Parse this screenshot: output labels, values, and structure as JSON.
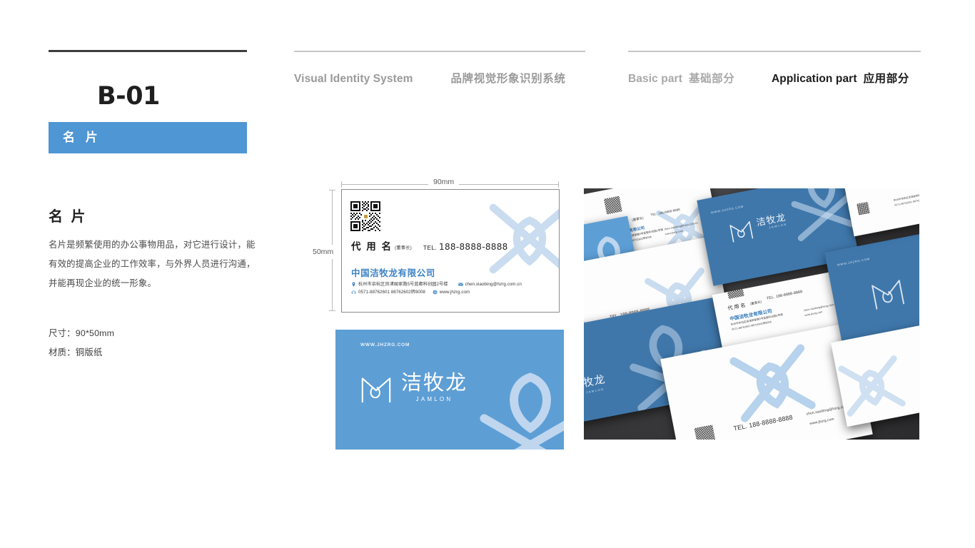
{
  "header": {
    "nav": [
      {
        "en": "Visual Identity System",
        "cn": "品牌视觉形象识别系统",
        "active": false
      },
      {
        "en": "Basic part",
        "cn": "基础部分",
        "active": false
      },
      {
        "en": "Application part",
        "cn": "应用部分",
        "active": true
      }
    ]
  },
  "left": {
    "code": "B-01",
    "band_label": "名 片",
    "section_title": "名 片",
    "body": "名片是频繁使用的办公事物用品，对它进行设计，能有效的提高企业的工作效率，与外界人员进行沟通，并能再现企业的统一形象。",
    "spec_size": "尺寸：90*50mm",
    "spec_material": "材质：铜版纸"
  },
  "dimensions": {
    "width_label": "90mm",
    "height_label": "50mm"
  },
  "card_front": {
    "person_name": "代 用 名",
    "person_title": "(董事长)",
    "tel_label": "TEL.",
    "tel_number": "188-8888-8888",
    "company": "中国洁牧龙有限公司",
    "address": "杭州市余杭区良渚娱家路5号蓝都科创园2号楼",
    "email": "chen.xiaobing@hzrg.com.cn",
    "phone": "0571-88762601 88762602转8008",
    "website": "www.jhzrg.com",
    "icons": {
      "address": "location-pin-icon",
      "email": "envelope-icon",
      "phone": "telephone-icon",
      "website": "globe-icon",
      "qr": "qr-code-icon"
    }
  },
  "card_back": {
    "url": "WWW.JHZRG.COM",
    "logo_cn": "洁牧龙",
    "logo_en": "JAMLON",
    "logo_mark": "jamlon-monogram-icon",
    "watermark": "jamlon-watermark-icon"
  },
  "photo_mockup": {
    "caption_items": [
      "代 用 名",
      "(董事长)",
      "TEL. 188-8888-8888",
      "中国洁牧龙有限公司",
      "杭州市余杭区良渚娱家路5号蓝都科创园2号楼",
      "0571-88762601 88762602转8008",
      "chen.xiaobing@hzrg.com.cn",
      "www.jhzrg.com",
      "WWW.JHZRG.COM",
      "洁牧龙",
      "JAMLON"
    ]
  },
  "colors": {
    "brand_blue": "#4f96d4",
    "card_blue": "#5d9ed5",
    "company_blue": "#3d83c4",
    "watermark_blue": "#c6dcf0",
    "rule_grey": "#c6c6c6",
    "rule_dark": "#3c3c3c",
    "nav_inactive": "#9a9a9a",
    "nav_active": "#1c1c1c"
  }
}
